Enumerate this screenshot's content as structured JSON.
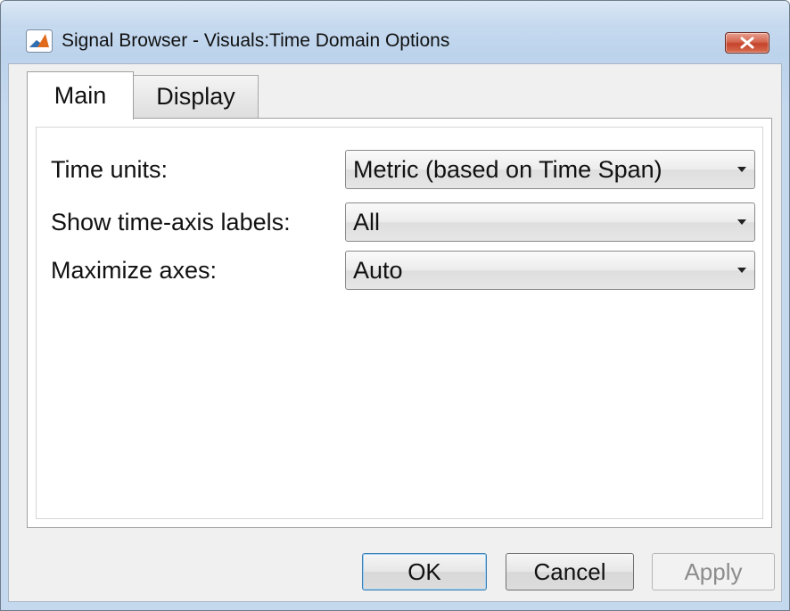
{
  "window": {
    "title": "Signal Browser - Visuals:Time Domain Options",
    "icon": "matlab-icon",
    "close_icon": "close-icon"
  },
  "tabs": [
    {
      "label": "Main",
      "selected": true
    },
    {
      "label": "Display",
      "selected": false
    }
  ],
  "fields": {
    "time_units": {
      "label": "Time units:",
      "value": "Metric (based on Time Span)"
    },
    "show_labels": {
      "label": "Show time-axis labels:",
      "value": "All"
    },
    "maximize_axes": {
      "label": "Maximize axes:",
      "value": "Auto"
    }
  },
  "buttons": {
    "ok": "OK",
    "cancel": "Cancel",
    "apply": "Apply",
    "apply_enabled": false
  },
  "colors": {
    "title_bar": "#c3d7ed",
    "close_button": "#c4422a",
    "dialog_bg": "#f0f0f0",
    "ok_focus_border": "#3c7fb1"
  }
}
